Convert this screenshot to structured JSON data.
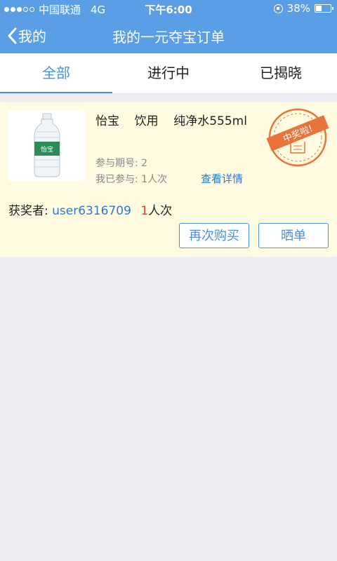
{
  "status_bar": {
    "carrier": "中国联通",
    "network": "4G",
    "time": "下午6:00",
    "battery": "38%",
    "battery_level": 0.38
  },
  "nav": {
    "back_label": "我的",
    "title": "我的一元夺宝订单"
  },
  "tabs": [
    {
      "label": "全部",
      "active": true
    },
    {
      "label": "进行中",
      "active": false
    },
    {
      "label": "已揭晓",
      "active": false
    }
  ],
  "order": {
    "product_title": "怡宝    饮用    纯净水555ml",
    "bottle_label": "怡宝",
    "period": "参与期号: 2",
    "joined": "我已参与: 1人次",
    "detail_link": "查看详情",
    "stamp_text": "中奖啦!",
    "winner_label": "获奖者:",
    "winner_user": "user6316709",
    "winner_count": "1",
    "winner_unit": "人次",
    "rebuy_button": "再次购买",
    "share_button": "晒单"
  },
  "colors": {
    "primary": "#5a9fe6",
    "accent_blue": "#4a90e2",
    "card_bg": "#fffbe0",
    "stamp_orange": "#e8743b",
    "count_red": "#e53935"
  }
}
